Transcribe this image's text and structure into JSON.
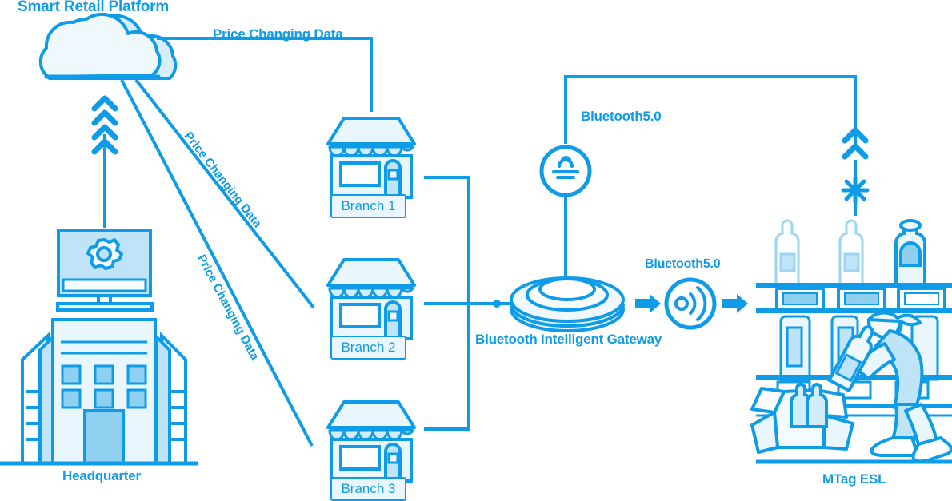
{
  "diagram": {
    "title": "Smart Retail Platform Architecture",
    "colors": {
      "accent": "#0e9ce8",
      "fill_light": "#eaf6fd",
      "fill_mid": "#bfe3f7",
      "fill_dark": "#8fd0f0",
      "background": "#ffffff"
    }
  },
  "labels": {
    "platform": "Smart Retail Platform",
    "price_changing_data_top": "Price Changing Data",
    "price_changing_data_diag1": "Price Changing Data",
    "price_changing_data_diag2": "Price Changing Data",
    "headquarter": "Headquarter",
    "branch_1": "Branch 1",
    "branch_2": "Branch 2",
    "branch_3": "Branch 3",
    "gateway": "Bluetooth Intelligent Gateway",
    "bluetooth_top": "Bluetooth5.0",
    "bluetooth_mid": "Bluetooth5.0",
    "esl": "MTag ESL"
  },
  "nodes": [
    {
      "id": "cloud",
      "name": "smart-retail-platform-cloud",
      "label": "Smart Retail Platform"
    },
    {
      "id": "hq",
      "name": "headquarter-building",
      "label": "Headquarter"
    },
    {
      "id": "branch1",
      "name": "branch-store-1",
      "label": "Branch 1"
    },
    {
      "id": "branch2",
      "name": "branch-store-2",
      "label": "Branch 2"
    },
    {
      "id": "branch3",
      "name": "branch-store-3",
      "label": "Branch 3"
    },
    {
      "id": "gateway",
      "name": "bluetooth-intelligent-gateway",
      "label": "Bluetooth Intelligent Gateway"
    },
    {
      "id": "antenna",
      "name": "broadcast-antenna-icon",
      "label": "Bluetooth5.0"
    },
    {
      "id": "signal",
      "name": "signal-emitter-icon",
      "label": "Bluetooth5.0"
    },
    {
      "id": "shelf",
      "name": "retail-shelf-with-esl-tags",
      "label": "MTag ESL"
    },
    {
      "id": "stocker",
      "name": "store-clerk-stocking-shelf",
      "label": "MTag ESL"
    }
  ],
  "icons": {
    "gear": "gear-icon",
    "cloud": "cloud-icon",
    "store": "store-front-icon",
    "monitor": "monitor-icon",
    "gateway_disc": "gateway-disc-icon",
    "antenna": "broadcast-antenna-icon",
    "speaker": "signal-wave-icon",
    "arrow_right": "arrow-right-icon",
    "chevron_up": "chevron-up-icon",
    "starburst": "starburst-icon",
    "bottle": "bottle-icon",
    "price_tag": "esl-price-tag-icon",
    "box": "open-box-icon",
    "person": "person-icon"
  }
}
